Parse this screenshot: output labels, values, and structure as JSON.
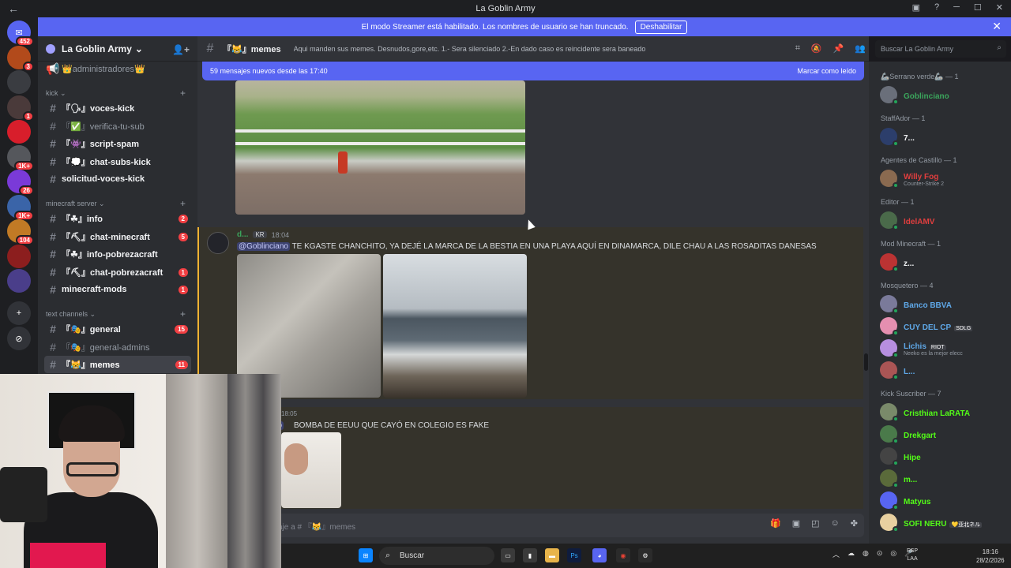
{
  "window": {
    "title": "La Goblin Army",
    "back_arrow": "←"
  },
  "banner": {
    "text": "El modo Streamer está habilitado. Los nombres de usuario se han truncado.",
    "button": "Deshabilitar",
    "close": "✕"
  },
  "servers": [
    {
      "badge": "452",
      "color": "#5865f2",
      "label": "✉"
    },
    {
      "badge": "3",
      "color": "#b24a1b",
      "label": ""
    },
    {
      "badge": "",
      "color": "#3a3c41",
      "label": ""
    },
    {
      "badge": "1",
      "color": "#4a3a3a",
      "label": ""
    },
    {
      "badge": "",
      "color": "#d81e2b",
      "label": ""
    },
    {
      "badge": "1K+",
      "color": "#55575c",
      "label": ""
    },
    {
      "badge": "26",
      "color": "#7a3ad8",
      "label": ""
    },
    {
      "badge": "1K+",
      "color": "#3a64a8",
      "label": ""
    },
    {
      "badge": "104",
      "color": "#c17a25",
      "label": ""
    },
    {
      "badge": "",
      "color": "#8c1e1e",
      "label": ""
    },
    {
      "badge": "",
      "color": "#4a3e8a",
      "label": ""
    },
    {
      "badge": "",
      "color": "#313338",
      "label": "+"
    },
    {
      "badge": "",
      "color": "#313338",
      "label": "⊘"
    }
  ],
  "sidebar": {
    "guild_name": "La Goblin Army",
    "top_channel": "👑administradores👑",
    "categories": [
      {
        "name": "kick",
        "plus": "+"
      },
      {
        "name": "minecraft server",
        "plus": "+"
      },
      {
        "name": "Text Channels",
        "plus": "+"
      }
    ],
    "channels": [
      {
        "name": "『🗣』voces-kick",
        "badge": "",
        "unread": true
      },
      {
        "name": "『✅』verifica-tu-sub",
        "badge": "",
        "unread": false
      },
      {
        "name": "『👾』script-spam",
        "badge": "",
        "unread": true
      },
      {
        "name": "『💭』chat-subs-kick",
        "badge": "",
        "unread": true
      },
      {
        "name": "solicitud-voces-kick",
        "badge": "",
        "unread": true
      },
      {
        "name": "『☘』info",
        "badge": "2",
        "unread": true
      },
      {
        "name": "『⛏』chat-minecraft",
        "badge": "5",
        "unread": true
      },
      {
        "name": "『☘』info-pobrezacraft",
        "badge": "",
        "unread": true
      },
      {
        "name": "『⛏』chat-pobrezacraft",
        "badge": "1",
        "unread": true
      },
      {
        "name": "minecraft-mods",
        "badge": "1",
        "unread": true
      },
      {
        "name": "『🎭』general",
        "badge": "15",
        "unread": true
      },
      {
        "name": "『🎭』general-admins",
        "badge": "",
        "unread": false
      },
      {
        "name": "『😹』memes",
        "badge": "11",
        "unread": true
      }
    ]
  },
  "topbar": {
    "channel": "『😹』memes",
    "topic": "Aqui manden sus memes. Desnudos,gore,etc. 1.- Sera silenciado 2.-En dado caso es reincidente sera baneado",
    "search_placeholder": "Buscar La Goblin Army"
  },
  "chat": {
    "new_messages": "59 mensajes nuevos desde las 17:40",
    "mark_read": "Marcar como leído",
    "msg1": {
      "user": "d...",
      "tag": "KR",
      "time": "18:04",
      "mention": "@Goblinciano",
      "text": "TE KGASTE CHANCHITO, YA DEJÉ LA MARCA DE LA BESTIA EN UNA PLAYA AQUÍ EN DINAMARCA, DILE CHAU A LAS ROSADITAS DANESAS"
    },
    "msg2": {
      "time": "18:05",
      "mention": "no",
      "text": "BOMBA DE EEUU QUE CAYÓ EN COLEGIO ES FAKE"
    },
    "composer_placeholder": "aje a # 『😹』memes"
  },
  "members": {
    "groups": [
      {
        "role": "🦾Serrano verde🦾 — 1",
        "members": [
          {
            "name": "Goblinciano",
            "color": "#3ba55c",
            "sub": "",
            "tag": ""
          }
        ]
      },
      {
        "role": "StaffAdor — 1",
        "members": [
          {
            "name": "7...",
            "color": "#f2f3f5",
            "sub": "",
            "tag": ""
          }
        ]
      },
      {
        "role": "Agentes de Castillo — 1",
        "members": [
          {
            "name": "Willy Fog",
            "color": "#e03e3e",
            "sub": "Counter-Strike 2",
            "tag": ""
          }
        ]
      },
      {
        "role": "Editor — 1",
        "members": [
          {
            "name": "IdelAMV",
            "color": "#e03e3e",
            "sub": "",
            "tag": ""
          }
        ]
      },
      {
        "role": "Mod Minecraft — 1",
        "members": [
          {
            "name": "z...",
            "color": "#f2f3f5",
            "sub": "",
            "tag": ""
          }
        ]
      },
      {
        "role": "Mosquetero — 4",
        "members": [
          {
            "name": "Banco BBVA",
            "color": "#5fa8e8",
            "sub": "",
            "tag": ""
          },
          {
            "name": "CUY DEL CP",
            "color": "#5fa8e8",
            "sub": "",
            "tag": "SDLG"
          },
          {
            "name": "Lichis",
            "color": "#5fa8e8",
            "sub": "Neeko es la mejor elecc",
            "tag": "RIOT"
          },
          {
            "name": "L...",
            "color": "#5fa8e8",
            "sub": "",
            "tag": ""
          }
        ]
      },
      {
        "role": "Kick Suscriber — 7",
        "members": [
          {
            "name": "Cristhian LaRATA",
            "color": "#53fc18",
            "sub": "",
            "tag": ""
          },
          {
            "name": "Drekgart",
            "color": "#53fc18",
            "sub": "",
            "tag": ""
          },
          {
            "name": "Hipe",
            "color": "#53fc18",
            "sub": "",
            "tag": ""
          },
          {
            "name": "m...",
            "color": "#53fc18",
            "sub": "",
            "tag": ""
          },
          {
            "name": "Matyus",
            "color": "#53fc18",
            "sub": "",
            "tag": ""
          },
          {
            "name": "SOFI NERU",
            "color": "#53fc18",
            "sub": "",
            "tag": "💛亚北ネル"
          }
        ]
      }
    ]
  },
  "taskbar": {
    "search": "Buscar",
    "lang1": "ESP",
    "lang2": "LAA",
    "time": "18:16",
    "date": "28/2/2026"
  }
}
